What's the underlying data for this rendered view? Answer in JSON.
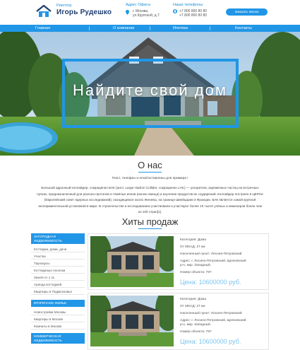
{
  "header": {
    "brand_tagline": "Риелтор",
    "brand_name": "Игорь Рудешко",
    "address_title": "Адрес Офиса",
    "address_line1": "г. Москва,",
    "address_line2": "ул.Крупской, д.7.",
    "phone_title": "Наши телефоны",
    "phone_line1": "+7 800 800 80 80",
    "phone_line2": "+7 800 800 80 80",
    "call_button": "Заказать звонок"
  },
  "nav": {
    "items": [
      "Главная",
      "О компании",
      "Ипотека",
      "Контакты"
    ]
  },
  "hero": {
    "title": "Найдите свой дом"
  },
  "about": {
    "title": "О нас",
    "intro": "Текст, телефон и email вставлены для примера !",
    "body": "Большой адронный коллайдер, сокращённо БАК (англ. Large Hadron Collider, сокращённо LHC) — ускоритель заряженных частиц на встречных пучках, предназначенный для разгона протонов и тяжёлых ионов (ионов свинца) и изучения продуктов их соударений. Коллайдер построен в ЦЕРНе (Европейский совет ядерных исследований), находящемся около Женевы, на границе Швейцарии и Франции. БАК является самой крупной экспериментальной установкой в мире. В строительстве и исследованиях участвовали и участвуют более 10 тысяч учёных и инженеров более чем из 100 стран[1]."
  },
  "hits": {
    "title": "Хиты продаж"
  },
  "sidebar": {
    "sections": [
      {
        "title": "ЗАГОРОДНАЯ НЕДВИЖИМОСТЬ",
        "items": [
          "Коттеджи, дома, дачи",
          "Участки",
          "Таунхаусы",
          "Коттеджные поселки",
          "Земля от 1 га",
          "Аренда коттеджей",
          "Квартиры в Подмосковье"
        ]
      },
      {
        "title": "ВТОРИЧНОЕ ЖИЛЬЕ",
        "items": [
          "Новостройки Москвы",
          "Квартиры в Москве",
          "Комнаты в Москве"
        ]
      },
      {
        "title": "КОММЕРЧЕСКАЯ НЕДВИЖИМОСТЬ",
        "items": []
      }
    ]
  },
  "listings": [
    {
      "category": "Категория: Дома",
      "distance": "От МКАД: 27 км",
      "settlement": "Населенный пункт: Лесная-Петровский",
      "address_l1": "Адрес: г. Лосино-Петровский, Щелковский",
      "address_l2": "р-н, мкр. Западный.",
      "object_no": "Номер объекта: 787",
      "price": "Цена: 10600000 руб."
    },
    {
      "category": "Категория: Дома",
      "distance": "От МКАД: 27 км",
      "settlement": "Населенный пункт: Лосино-Петровский",
      "address_l1": "Адрес: г. Лосино-Петровский, Щелковский",
      "address_l2": "р-н, мкр. Западный.",
      "object_no": "Номер объекта: 787",
      "price": "Цена: 10600000 руб."
    }
  ],
  "colors": {
    "accent": "#2196e6",
    "price": "#7cc3ee",
    "brand": "#1f3e6e"
  }
}
